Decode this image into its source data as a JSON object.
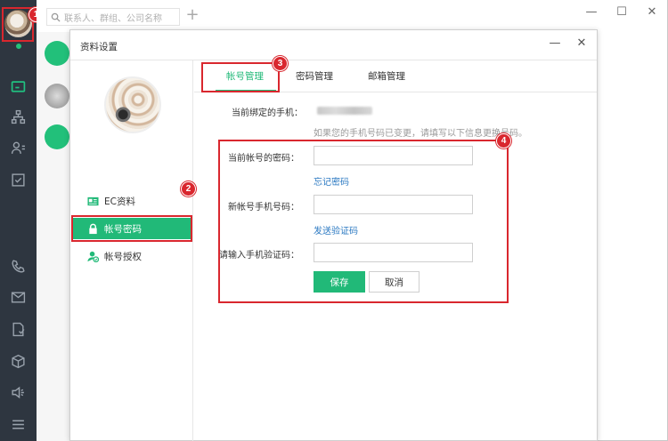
{
  "search": {
    "placeholder": "联系人、群组、公司名称"
  },
  "window_controls": {
    "minimize": "—",
    "maximize": "☐",
    "close": "✕"
  },
  "dialog": {
    "title": "资料设置",
    "minimize": "—",
    "close": "✕",
    "menu": [
      {
        "label": "EC资料",
        "icon": "id-card-icon"
      },
      {
        "label": "帐号密码",
        "icon": "lock-icon",
        "active": true
      },
      {
        "label": "帐号授权",
        "icon": "user-shield-icon"
      }
    ],
    "tabs": [
      {
        "label": "帐号管理",
        "active": true
      },
      {
        "label": "密码管理"
      },
      {
        "label": "邮箱管理"
      }
    ],
    "form": {
      "current_phone_label": "当前绑定的手机：",
      "hint": "如果您的手机号码已变更，请填写以下信息更换号码。",
      "current_password_label": "当前帐号的密码：",
      "forgot_link": "忘记密码",
      "new_phone_label": "新帐号手机号码：",
      "send_code_link": "发送验证码",
      "code_label": "请输入手机验证码：",
      "save_label": "保存",
      "cancel_label": "取消"
    }
  },
  "badges": [
    "1",
    "2",
    "3",
    "4"
  ],
  "colors": {
    "accent": "#21b978",
    "highlight": "#d9272e",
    "link": "#2b79c2",
    "rail": "#2e3640"
  }
}
